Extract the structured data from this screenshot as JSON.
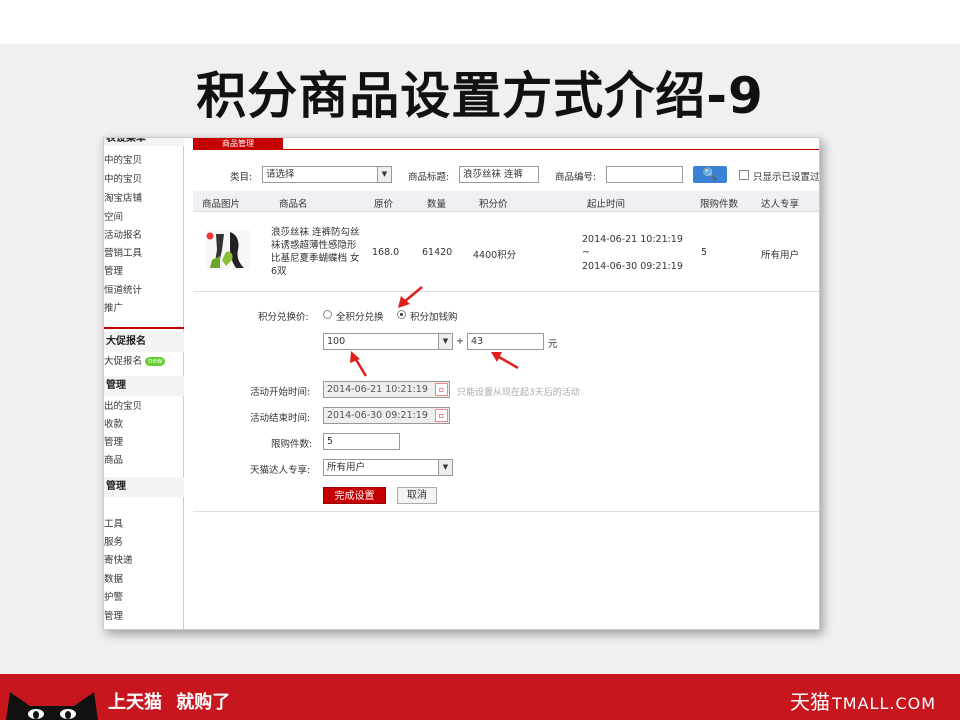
{
  "slide": {
    "title": "积分商品设置方式介绍-9"
  },
  "sidebar": {
    "items_top": [
      "表设菜单",
      "中的宝贝",
      "中的宝贝",
      "淘宝店铺",
      "空间",
      "活动报名",
      "营销工具",
      "管理",
      "恒道统计",
      "推广"
    ],
    "section1": {
      "header": "大促报名",
      "items": [
        "大促报名"
      ],
      "badge": "new"
    },
    "section2": {
      "header": "管理",
      "items": [
        "出的宝贝",
        "收款",
        "管理",
        "商品"
      ]
    },
    "section3": {
      "header": "管理",
      "items": [
        "",
        "工具",
        "服务",
        "寄快递",
        "数据",
        "护警",
        "管理"
      ]
    }
  },
  "tab": {
    "label": "商品管理"
  },
  "filter": {
    "category_label": "类目:",
    "category_value": "请选择",
    "title_label": "商品标题:",
    "title_value": "浪莎丝袜 连裤",
    "code_label": "商品编号:",
    "code_value": "",
    "search_icon": "search-icon",
    "only_label": "只显示已设置过"
  },
  "table": {
    "headers": [
      "商品图片",
      "商品名",
      "原价",
      "数量",
      "积分价",
      "起止时间",
      "限购件数",
      "达人专享"
    ],
    "row": {
      "name": "浪莎丝袜 连裤防勾丝袜诱惑超薄性感隐形比基尼夏季蝴蝶档 女6双",
      "price": "168.0",
      "quantity": "61420",
      "points": "4400积分",
      "time_start": "2014-06-21 10:21:19",
      "time_sep": "~",
      "time_end": "2014-06-30 09:21:19",
      "limit": "5",
      "vip": "所有用户"
    }
  },
  "form": {
    "exchange_label": "积分兑换价:",
    "opt_full": "全积分兑换",
    "opt_cash": "积分加钱购",
    "points_value": "100",
    "plus": "+",
    "cash_value": "43",
    "cash_unit": "元",
    "start_label": "活动开始时间:",
    "start_value": "2014-06-21 10:21:19",
    "start_hint": "只能设置从现在起3天后的活动",
    "end_label": "活动结束时间:",
    "end_value": "2014-06-30 09:21:19",
    "limit_label": "限购件数:",
    "limit_value": "5",
    "vip_label": "天猫达人专享:",
    "vip_value": "所有用户",
    "submit": "完成设置",
    "cancel": "取消"
  },
  "footer": {
    "slogan1": "上天猫",
    "slogan2": "就购了",
    "brand_cn": "天猫",
    "brand_en": "TMALL.COM"
  },
  "colors": {
    "brand_red": "#c8161e",
    "button_red": "#c40000",
    "search_blue": "#3a82d6",
    "arrow_red": "#e0201b"
  }
}
